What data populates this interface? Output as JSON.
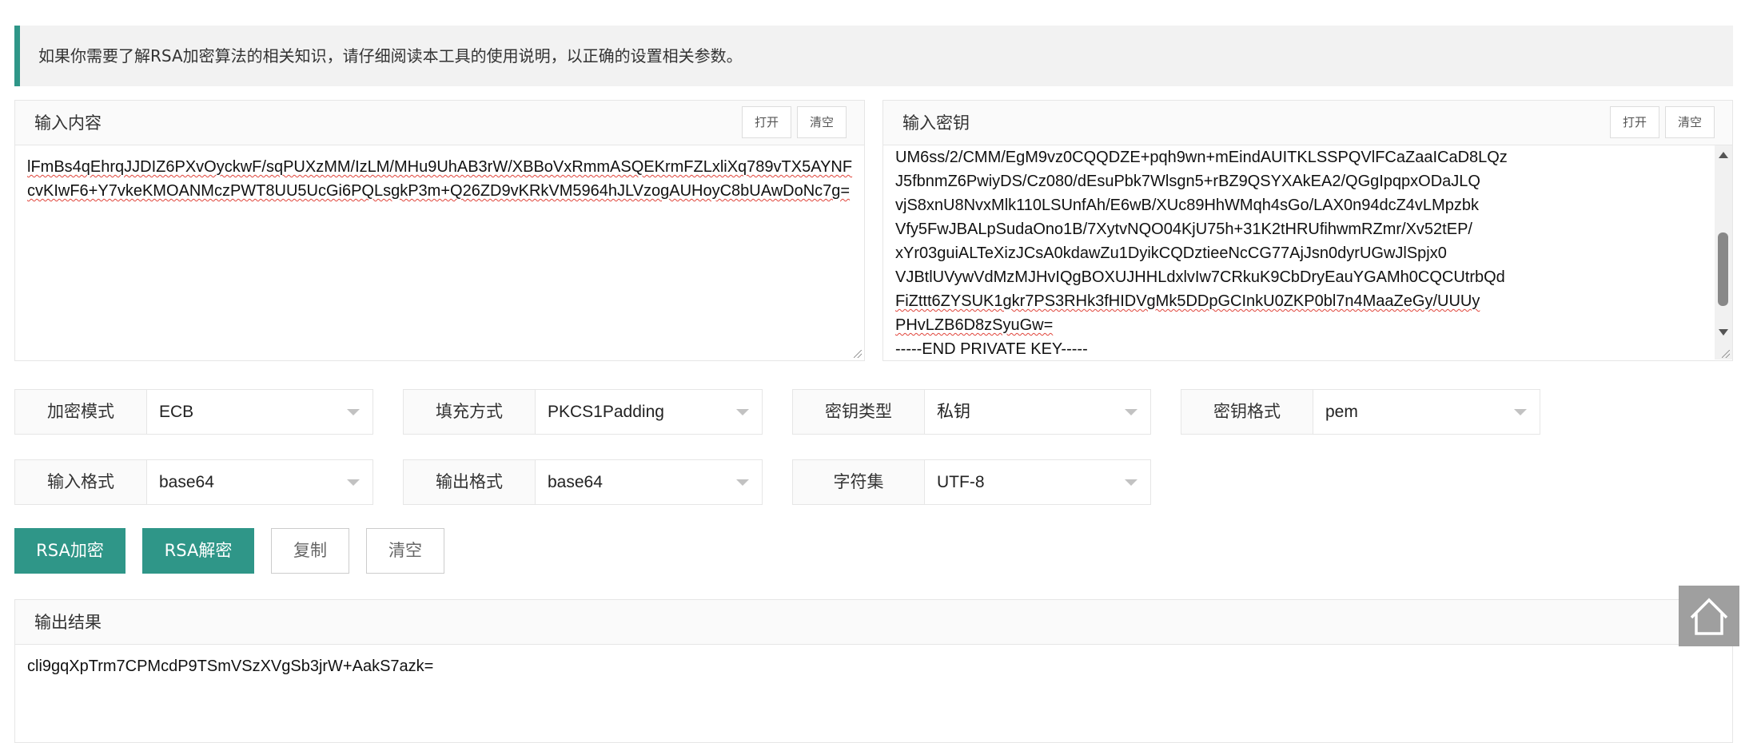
{
  "notice": {
    "text": "如果你需要了解RSA加密算法的相关知识，请仔细阅读本工具的使用说明，以正确的设置相关参数。"
  },
  "input_panel": {
    "title": "输入内容",
    "open_label": "打开",
    "clear_label": "清空",
    "value": "lFmBs4qEhrqJJDIZ6PXvOyckwF/sqPUXzMM/IzLM/MHu9UhAB3rW/XBBoVxRmmASQEKrmFZLxliXq789vTX5AYNFcvKIwF6+Y7vkeKMOANMczPWT8UU5UcGi6PQLsgkP3m+Q26ZD9vKRkVM5964hJLVzogAUHoyC8bUAwDoNc7g="
  },
  "key_panel": {
    "title": "输入密钥",
    "open_label": "打开",
    "clear_label": "清空",
    "visible_lines": [
      "UM6ss/2/CMM/EgM9vz0CQQDZE+pqh9wn+mEindAUITKLSSPQVlFCaZaaICaD8LQz",
      "J5fbnmZ6PwiyDS/Cz080/dEsuPbk7Wlsgn5+rBZ9QSYXAkEA2/QGgIpqpxODaJLQ",
      "vjS8xnU8NvxMlk110LSUnfAh/E6wB/XUc89HhWMqh4sGo/LAX0n94dcZ4vLMpzbk",
      "Vfy5FwJBALpSudaOno1B/7XytvNQO04KjU75h+31K2tHRUfihwmRZmr/Xv52tEP/",
      "xYr03guiALTeXizJCsA0kdawZu1DyikCQDztieeNcCG77AjJsn0dyrUGwJlSpjx0",
      "VJBtlUVywVdMzMJHvIQgBOXUJHHLdxlvIw7CRkuK9CbDryEauYGAMh0CQCUtrbQd",
      "FiZttt6ZYSUK1gkr7PS3RHk3fHIDVgMk5DDpGCInkU0ZKP0bl7n4MaaZeGy/UUUy",
      "PHvLZB6D8zSyuGw=",
      "-----END PRIVATE KEY-----"
    ]
  },
  "options": {
    "mode": {
      "label": "加密模式",
      "value": "ECB"
    },
    "padding": {
      "label": "填充方式",
      "value": "PKCS1Padding"
    },
    "key_type": {
      "label": "密钥类型",
      "value": "私钥"
    },
    "key_format": {
      "label": "密钥格式",
      "value": "pem"
    },
    "input_format": {
      "label": "输入格式",
      "value": "base64"
    },
    "output_format": {
      "label": "输出格式",
      "value": "base64"
    },
    "charset": {
      "label": "字符集",
      "value": "UTF-8"
    }
  },
  "actions": {
    "encrypt_label": "RSA加密",
    "decrypt_label": "RSA解密",
    "copy_label": "复制",
    "clear_label": "清空"
  },
  "output_panel": {
    "title": "输出结果",
    "value": "cli9gqXpTrm7CPMcdP9TSmVSzXVgSb3jrW+AakS7azk="
  },
  "icons": {
    "back_to_top": "home-icon"
  },
  "colors": {
    "accent": "#2f9688",
    "notice_bg": "#f2f2f2"
  }
}
